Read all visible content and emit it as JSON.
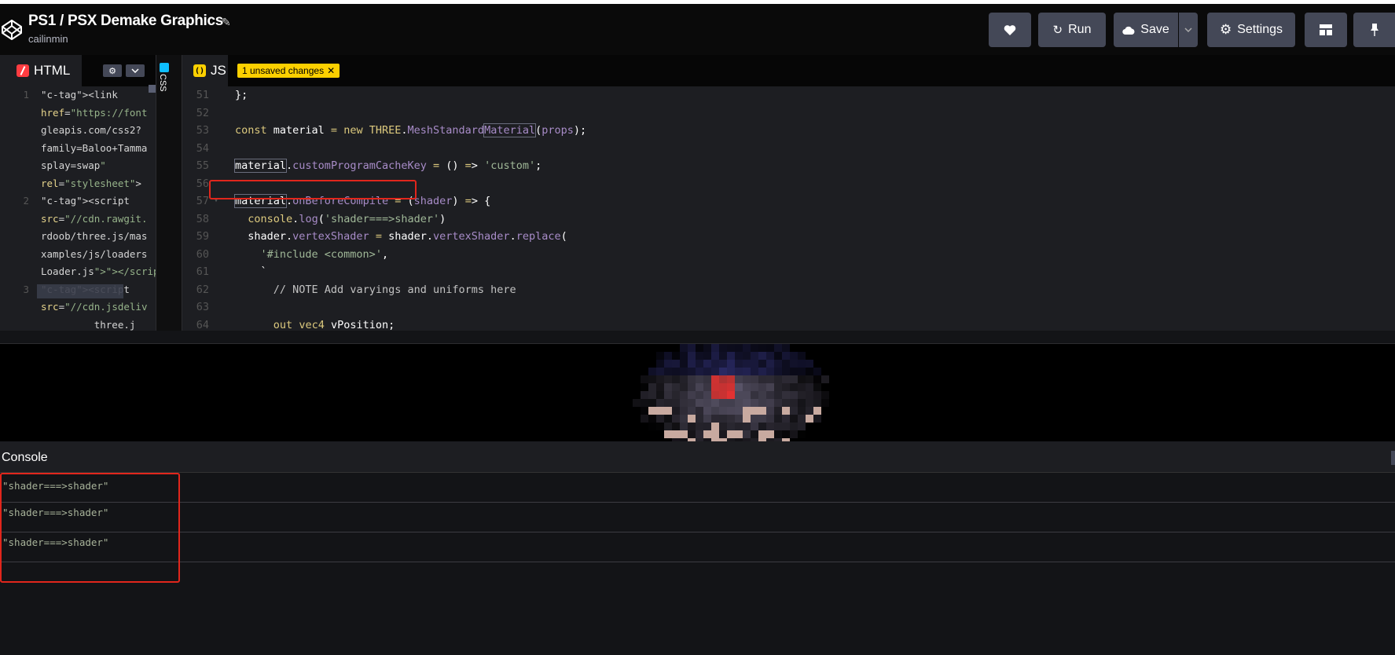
{
  "header": {
    "title": "PS1 / PSX Demake Graphics",
    "author": "cailinmin",
    "buttons": {
      "run": "Run",
      "save": "Save",
      "settings": "Settings"
    }
  },
  "html_editor": {
    "tab_label": "HTML",
    "lines": [
      {
        "n": "1",
        "text": "<link"
      },
      {
        "n": "",
        "text": "href=\"https://font"
      },
      {
        "n": "",
        "text": "gleapis.com/css2?"
      },
      {
        "n": "",
        "text": "family=Baloo+Tamma"
      },
      {
        "n": "",
        "text": "splay=swap\""
      },
      {
        "n": "",
        "text": "rel=\"stylesheet\">"
      },
      {
        "n": "2",
        "text": "<script"
      },
      {
        "n": "",
        "text": "src=\"//cdn.rawgit."
      },
      {
        "n": "",
        "text": "rdoob/three.js/mas"
      },
      {
        "n": "",
        "text": "xamples/js/loaders"
      },
      {
        "n": "",
        "text": "Loader.js\"></scrip"
      },
      {
        "n": "3",
        "text": "<script"
      },
      {
        "n": "",
        "text": "src=\"//cdn.jsdeliv"
      },
      {
        "n": "",
        "text": "         three.j"
      }
    ]
  },
  "css_editor": {
    "tab_label": "CSS"
  },
  "js_editor": {
    "tab_label": "JS",
    "unsaved_badge": "1 unsaved changes",
    "lines": [
      {
        "n": "51",
        "text": "};"
      },
      {
        "n": "52",
        "text": ""
      },
      {
        "n": "53",
        "text": "const material = new THREE.MeshStandardMaterial(props);"
      },
      {
        "n": "54",
        "text": ""
      },
      {
        "n": "55",
        "text": "material.customProgramCacheKey = () => 'custom';"
      },
      {
        "n": "56",
        "text": ""
      },
      {
        "n": "57",
        "text": "material.onBeforeCompile = (shader) => {"
      },
      {
        "n": "58",
        "text": "  console.log('shader===>shader')"
      },
      {
        "n": "59",
        "text": "  shader.vertexShader = shader.vertexShader.replace("
      },
      {
        "n": "60",
        "text": "    '#include <common>',"
      },
      {
        "n": "61",
        "text": "    `"
      },
      {
        "n": "62",
        "text": "      // NOTE Add varyings and uniforms here"
      },
      {
        "n": "63",
        "text": ""
      },
      {
        "n": "64",
        "text": "      out vec4 vPosition;"
      }
    ]
  },
  "console": {
    "title": "Console",
    "logs": [
      "\"shader===>shader\"",
      "\"shader===>shader\"",
      "\"shader===>shader\""
    ]
  },
  "colors": {
    "background": "#131417",
    "editor_bg": "#1d1e22",
    "button_bg": "#444857",
    "annotation_red": "#e1261c",
    "badge_yellow": "#fcd000",
    "html_red": "#ff3c41",
    "css_blue": "#0ebeff"
  },
  "icons": [
    "codepen-logo-icon",
    "pencil-icon",
    "heart-icon",
    "refresh-icon",
    "cloud-icon",
    "chevron-down-icon",
    "gear-icon",
    "layout-icon",
    "pin-icon",
    "close-icon"
  ]
}
